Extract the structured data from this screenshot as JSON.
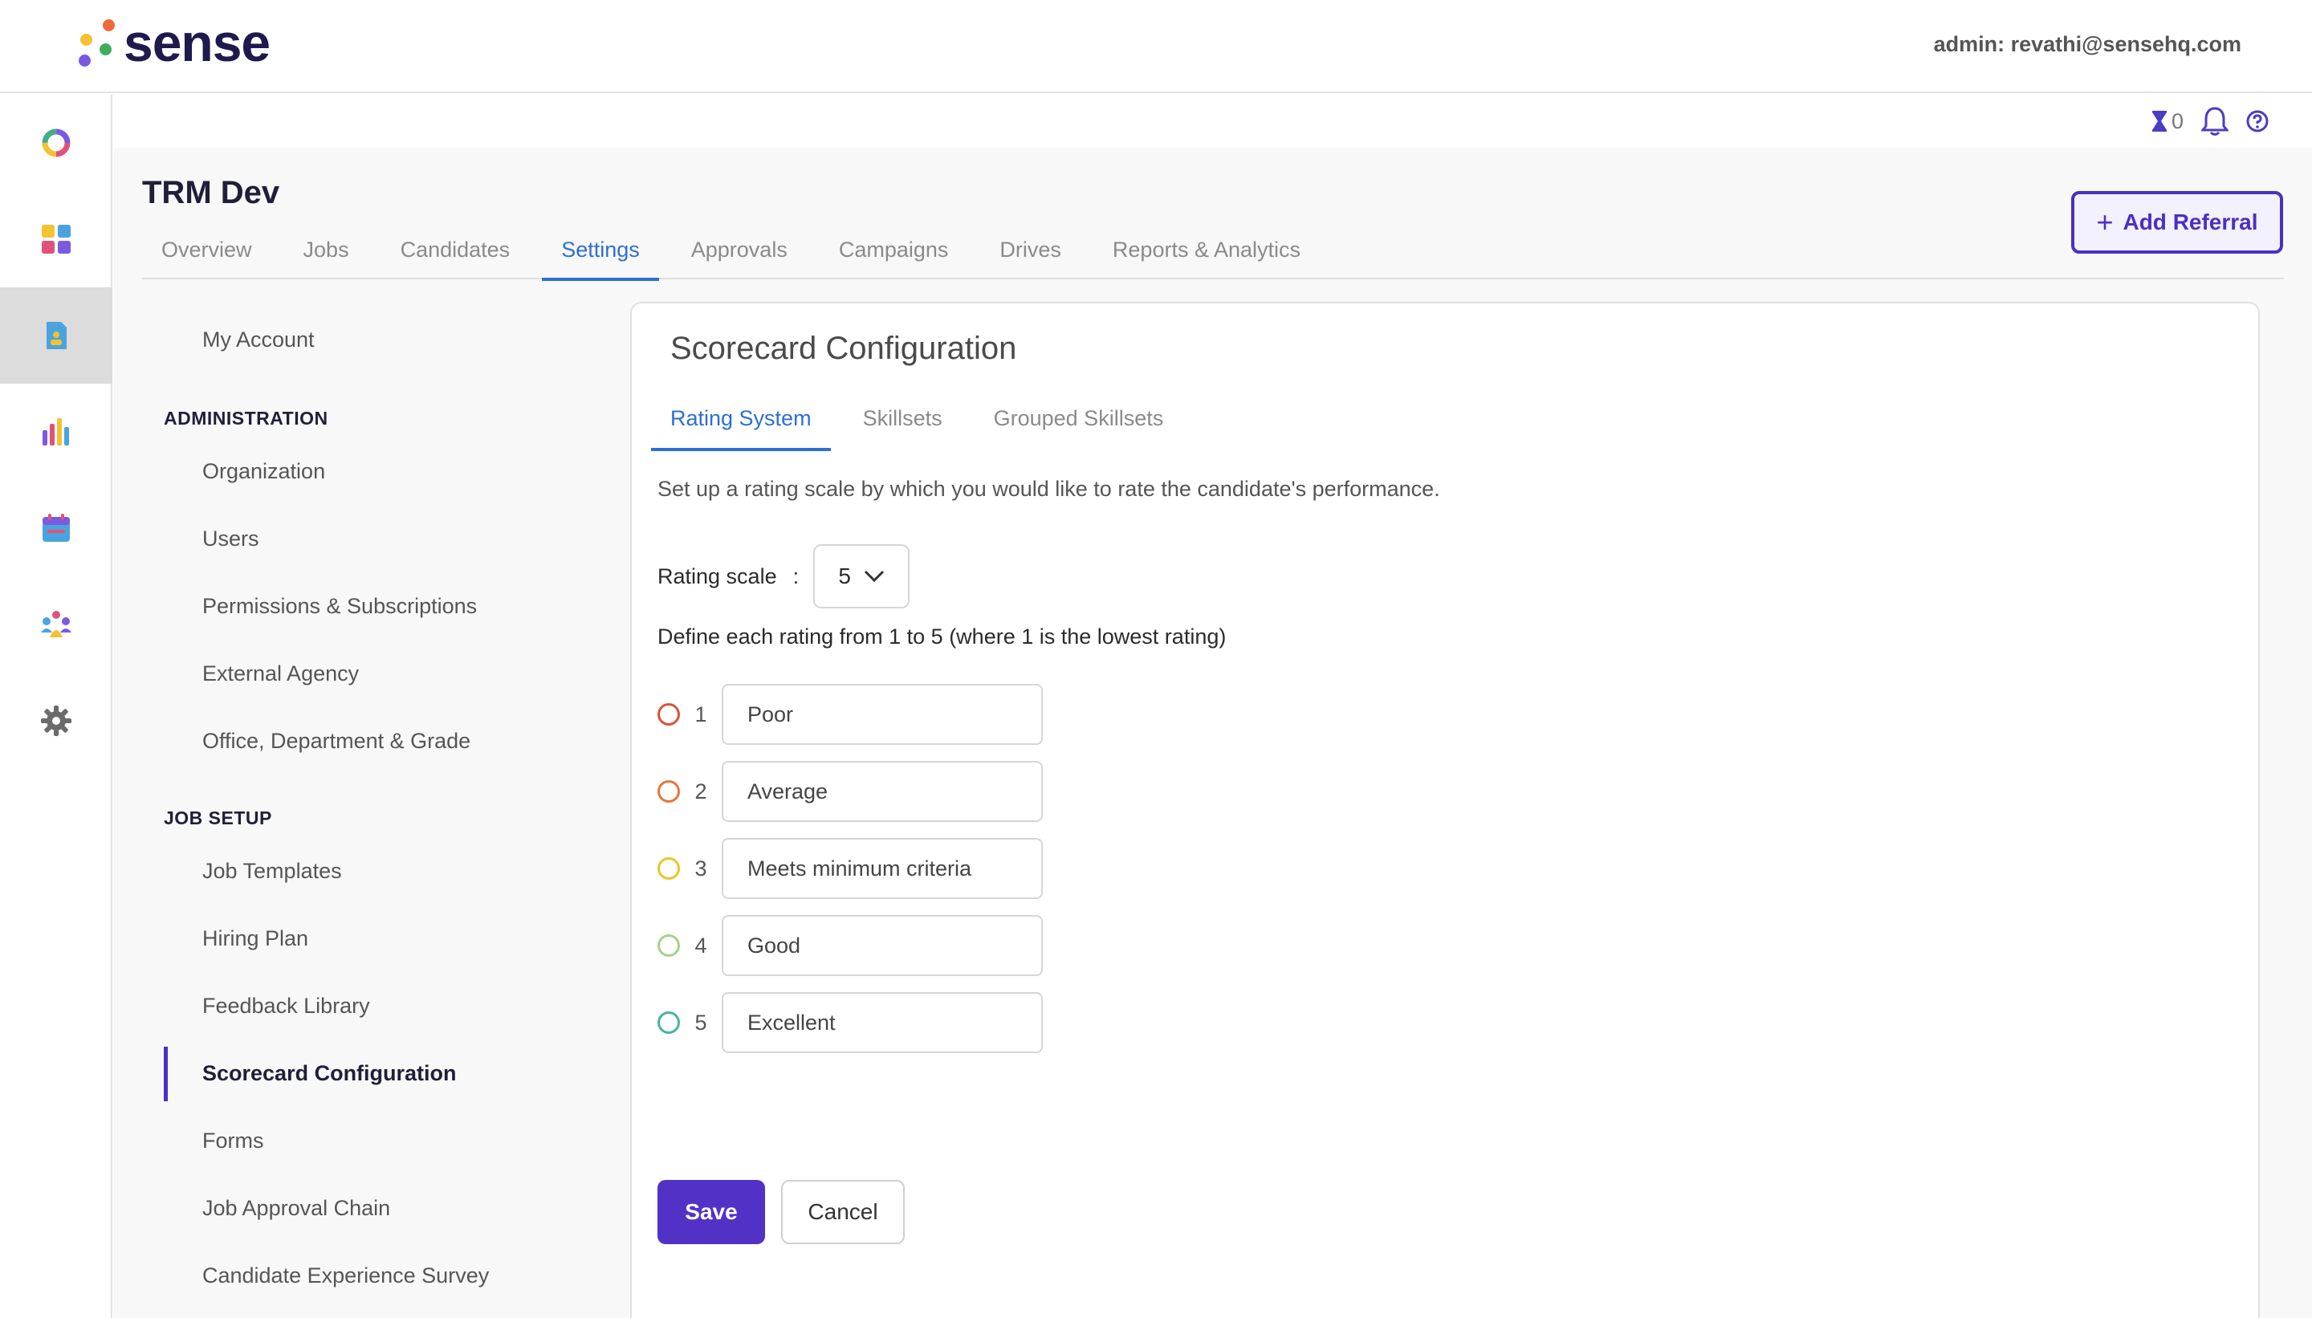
{
  "app": {
    "logo_text": "sense",
    "admin_label": "admin: revathi@sensehq.com"
  },
  "utility": {
    "hourglass_count": "0"
  },
  "page": {
    "title": "TRM Dev",
    "add_referral_label": "Add Referral"
  },
  "tabs": [
    {
      "label": "Overview",
      "active": false
    },
    {
      "label": "Jobs",
      "active": false
    },
    {
      "label": "Candidates",
      "active": false
    },
    {
      "label": "Settings",
      "active": true
    },
    {
      "label": "Approvals",
      "active": false
    },
    {
      "label": "Campaigns",
      "active": false
    },
    {
      "label": "Drives",
      "active": false
    },
    {
      "label": "Reports & Analytics",
      "active": false
    }
  ],
  "settings_nav": {
    "my_account": "My Account",
    "administration_header": "ADMINISTRATION",
    "administration_items": [
      "Organization",
      "Users",
      "Permissions & Subscriptions",
      "External Agency",
      "Office, Department & Grade"
    ],
    "job_setup_header": "JOB SETUP",
    "job_setup_items": [
      "Job Templates",
      "Hiring Plan",
      "Feedback Library",
      "Scorecard Configuration",
      "Forms",
      "Job Approval Chain",
      "Candidate Experience Survey"
    ],
    "active_item": "Scorecard Configuration"
  },
  "scorecard": {
    "title": "Scorecard Configuration",
    "subtabs": [
      "Rating System",
      "Skillsets",
      "Grouped Skillsets"
    ],
    "description": "Set up a rating scale by which you would like to rate the candidate's performance.",
    "scale_label": "Rating scale",
    "scale_colon": ":",
    "scale_value": "5",
    "define_text": "Define each rating from 1 to 5 (where 1 is the lowest rating)",
    "ratings": [
      {
        "num": "1",
        "label": "Poor",
        "color": "#d9533b"
      },
      {
        "num": "2",
        "label": "Average",
        "color": "#e8763a"
      },
      {
        "num": "3",
        "label": "Meets minimum criteria",
        "color": "#e8c52e"
      },
      {
        "num": "4",
        "label": "Good",
        "color": "#a8d08d"
      },
      {
        "num": "5",
        "label": "Excellent",
        "color": "#49b39c"
      }
    ],
    "save_label": "Save",
    "cancel_label": "Cancel"
  },
  "colors": {
    "brand": "#4b2fc2",
    "tab_active": "#2d6fd1"
  },
  "rail_icons": [
    "loop-icon",
    "dashboard-icon",
    "document-icon",
    "analytics-icon",
    "calendar-icon",
    "people-icon",
    "gear-icon"
  ]
}
